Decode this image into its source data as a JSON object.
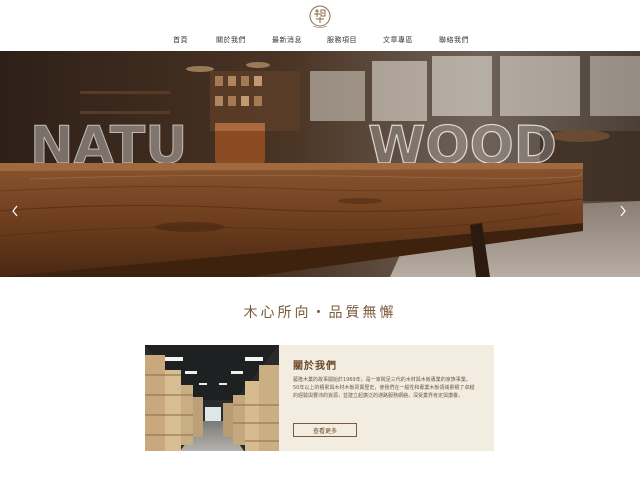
{
  "header": {
    "logo_icon": "seal-logo-icon",
    "nav": [
      {
        "label": "首頁"
      },
      {
        "label": "關於我們"
      },
      {
        "label": "最新消息"
      },
      {
        "label": "服務項目"
      },
      {
        "label": "文章專區"
      },
      {
        "label": "聯絡我們"
      }
    ]
  },
  "hero": {
    "text_left": "NATU",
    "text_right": "WOOD",
    "prev_icon": "chevron-left-icon",
    "next_icon": "chevron-right-icon"
  },
  "tagline": "木心所向・品質無懈",
  "about": {
    "title": "關於我們",
    "paragraph1": "藝隆木業的故事開始於1969年，是一家跨足三代的木材與木板專業的家族事業。",
    "paragraph2": "50年以上的積累與木材木板買賣歷史，使我們在一般性和專業木板領域累積了卓越的經驗與豐沛的資源，並建立起廣泛的通路服務網絡，深受業界肯定與讚譽。",
    "button_label": "查看更多"
  },
  "colors": {
    "brand_brown": "#7a5a3a",
    "panel_bg": "#f3ece0"
  }
}
